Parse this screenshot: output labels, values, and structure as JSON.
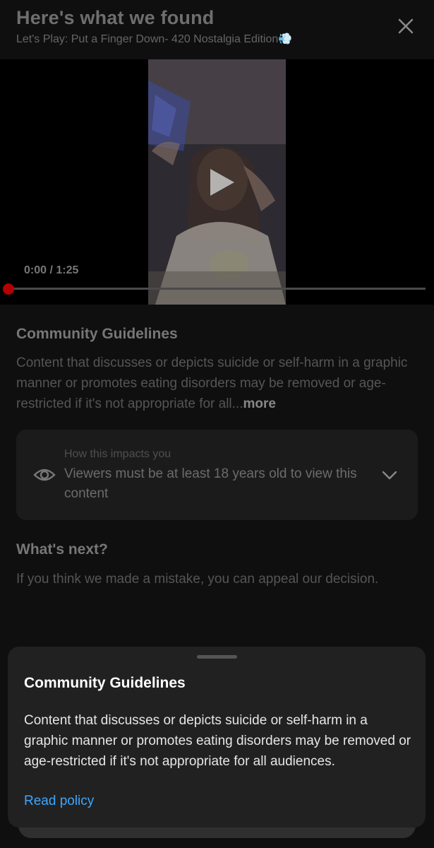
{
  "header": {
    "title": "Here's what we found",
    "subtitle": "Let's Play: Put a Finger Down- 420 Nostalgia Edition💨"
  },
  "video": {
    "time_display": "0:00 / 1:25",
    "progress": 0
  },
  "guidelines": {
    "title": "Community Guidelines",
    "text": "Content that discusses or depicts suicide or self-harm in a graphic manner or promotes eating disorders may be removed or age-restricted if it's not appropriate for all...",
    "more_label": "more"
  },
  "impact": {
    "label": "How this impacts you",
    "text": "Viewers must be at least 18 years old to view this content",
    "icon": "eye-icon"
  },
  "next": {
    "title": "What's next?",
    "text": "If you think we made a mistake, you can appeal our decision."
  },
  "sheet": {
    "title": "Community Guidelines",
    "text": "Content that discusses or depicts suicide or self-harm in a graphic manner or promotes eating disorders may be removed or age-restricted if it's not appropriate for all audiences.",
    "link_label": "Read policy"
  },
  "colors": {
    "accent_link": "#3ea6ff",
    "progress_red": "#cc0000",
    "sheet_bg": "#212121"
  }
}
